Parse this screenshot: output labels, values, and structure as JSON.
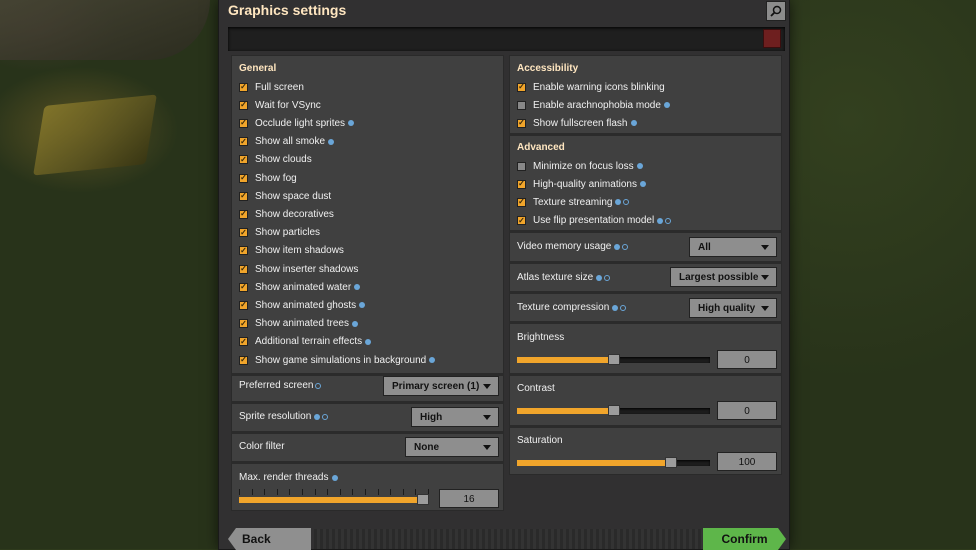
{
  "window": {
    "title": "Graphics settings"
  },
  "general": {
    "title": "General",
    "items": [
      {
        "label": "Full screen",
        "checked": true,
        "info": false
      },
      {
        "label": "Wait for VSync",
        "checked": true,
        "info": false
      },
      {
        "label": "Occlude light sprites",
        "checked": true,
        "info": true
      },
      {
        "label": "Show all smoke",
        "checked": true,
        "info": true
      },
      {
        "label": "Show clouds",
        "checked": true,
        "info": false
      },
      {
        "label": "Show fog",
        "checked": true,
        "info": false
      },
      {
        "label": "Show space dust",
        "checked": true,
        "info": false
      },
      {
        "label": "Show decoratives",
        "checked": true,
        "info": false
      },
      {
        "label": "Show particles",
        "checked": true,
        "info": false
      },
      {
        "label": "Show item shadows",
        "checked": true,
        "info": false
      },
      {
        "label": "Show inserter shadows",
        "checked": true,
        "info": false
      },
      {
        "label": "Show animated water",
        "checked": true,
        "info": true
      },
      {
        "label": "Show animated ghosts",
        "checked": true,
        "info": true
      },
      {
        "label": "Show animated trees",
        "checked": true,
        "info": true
      },
      {
        "label": "Additional terrain effects",
        "checked": true,
        "info": true
      },
      {
        "label": "Show game simulations in background",
        "checked": true,
        "info": true
      }
    ],
    "preferred_screen": {
      "label": "Preferred screen",
      "value": "Primary screen (1)"
    },
    "sprite_resolution": {
      "label": "Sprite resolution",
      "value": "High"
    },
    "color_filter": {
      "label": "Color filter",
      "value": "None"
    },
    "render_threads": {
      "label": "Max. render threads",
      "value": "16",
      "fraction": 1.0
    }
  },
  "accessibility": {
    "title": "Accessibility",
    "items": [
      {
        "label": "Enable warning icons blinking",
        "checked": true
      },
      {
        "label": "Enable arachnophobia mode",
        "checked": false
      },
      {
        "label": "Show fullscreen flash",
        "checked": true
      }
    ]
  },
  "advanced": {
    "title": "Advanced",
    "items": [
      {
        "label": "Minimize on focus loss",
        "checked": false
      },
      {
        "label": "High-quality animations",
        "checked": true
      },
      {
        "label": "Texture streaming",
        "checked": true
      },
      {
        "label": "Use flip presentation model",
        "checked": true
      }
    ],
    "video_memory": {
      "label": "Video memory usage",
      "value": "All"
    },
    "atlas_size": {
      "label": "Atlas texture size",
      "value": "Largest possible"
    },
    "texture_compression": {
      "label": "Texture compression",
      "value": "High quality"
    },
    "brightness": {
      "label": "Brightness",
      "value": "0",
      "fraction": 0.5
    },
    "contrast": {
      "label": "Contrast",
      "value": "0",
      "fraction": 0.5
    },
    "saturation": {
      "label": "Saturation",
      "value": "100",
      "fraction": 0.8
    }
  },
  "footer": {
    "back": "Back",
    "confirm": "Confirm"
  },
  "colors": {
    "accent": "#f1a52b",
    "confirm": "#5eb64a",
    "title": "#ffe6c0"
  }
}
